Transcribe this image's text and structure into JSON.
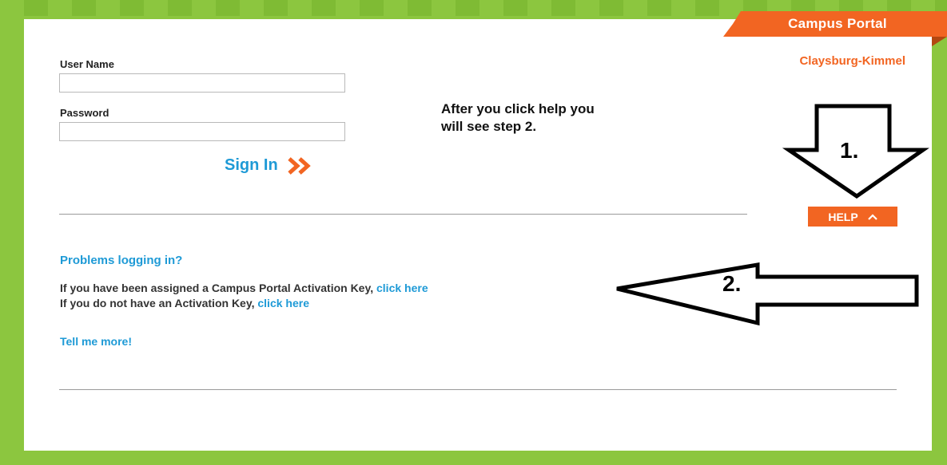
{
  "header": {
    "banner_title": "Campus Portal",
    "district_name": "Claysburg-Kimmel"
  },
  "login": {
    "username_label": "User Name",
    "username_value": "",
    "password_label": "Password",
    "password_value": "",
    "signin_label": "Sign In",
    "signin_icon": "double-chevron-right"
  },
  "annotation": {
    "note_line1": "After you click help you",
    "note_line2": "will see step 2.",
    "step1_label": "1.",
    "step2_label": "2."
  },
  "help": {
    "label": "HELP",
    "icon": "chevron-up"
  },
  "problems": {
    "heading": "Problems logging in?",
    "line1_text": "If you have been assigned a Campus Portal Activation Key, ",
    "line1_link": "click here",
    "line2_text": "If you do not have an Activation Key, ",
    "line2_link": "click here",
    "tell_more": "Tell me more!"
  },
  "colors": {
    "background_green": "#8cc63f",
    "accent_orange": "#f26522",
    "link_blue": "#1e9ad6"
  }
}
